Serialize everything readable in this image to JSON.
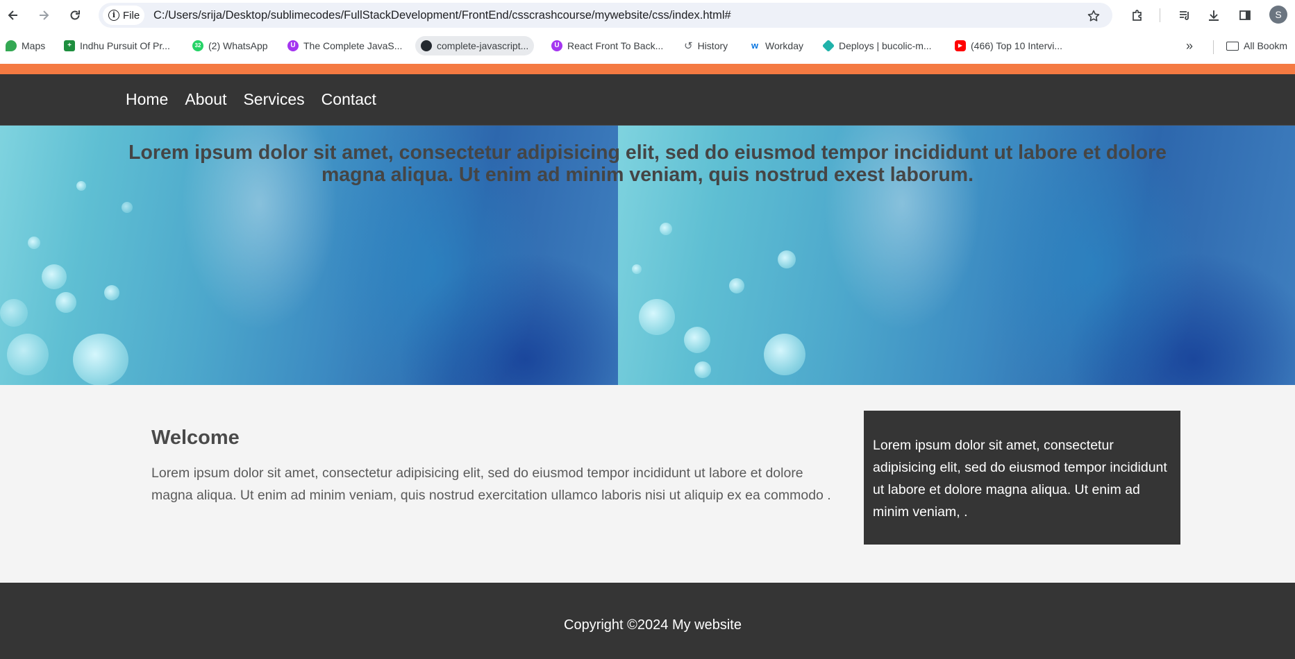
{
  "browser": {
    "site_chip_label": "File",
    "url": "C:/Users/srija/Desktop/sublimecodes/FullStackDevelopment/FrontEnd/csscrashcourse/mywebsite/css/index.html#",
    "profile_initial": "S",
    "bookmarks": [
      {
        "label": "Maps",
        "icon": "maps-icon",
        "color": "#34a853"
      },
      {
        "label": "Indhu Pursuit Of Pr...",
        "icon": "sheets-icon",
        "color": "#1e8e3e"
      },
      {
        "label": "(2) WhatsApp",
        "icon": "whatsapp-icon",
        "color": "#25d366",
        "badge": "32"
      },
      {
        "label": "The Complete JavaS...",
        "icon": "udemy-icon",
        "color": "#a435f0"
      },
      {
        "label": "complete-javascript...",
        "icon": "github-icon",
        "color": "#24292f"
      },
      {
        "label": "React Front To Back...",
        "icon": "udemy-icon",
        "color": "#a435f0"
      },
      {
        "label": "History",
        "icon": "history-icon",
        "color": "#5f6368"
      },
      {
        "label": "Workday",
        "icon": "workday-icon",
        "color": "#f5a623"
      },
      {
        "label": "Deploys | bucolic-m...",
        "icon": "netlify-icon",
        "color": "#20b2aa"
      },
      {
        "label": "(466) Top 10 Intervi...",
        "icon": "youtube-icon",
        "color": "#ff0000"
      }
    ],
    "all_bookmarks_label": "All Bookm"
  },
  "nav": {
    "items": [
      "Home",
      "About",
      "Services",
      "Contact"
    ]
  },
  "showcase": {
    "heading": "Lorem ipsum dolor sit amet, consectetur adipisicing elit, sed do eiusmod tempor incididunt ut labore et dolore magna aliqua. Ut enim ad minim veniam, quis nostrud exest laborum."
  },
  "main": {
    "title": "Welcome",
    "text": "Lorem ipsum dolor sit amet, consectetur adipisicing elit, sed do eiusmod tempor incididunt ut labore et dolore magna aliqua. Ut enim ad minim veniam, quis nostrud exercitation ullamco laboris nisi ut aliquip ex ea commodo ."
  },
  "sidebar": {
    "text": "Lorem ipsum dolor sit amet, consectetur adipisicing elit, sed do eiusmod tempor incididunt ut labore et dolore magna aliqua. Ut enim ad minim veniam, ."
  },
  "footer": {
    "text": "Copyright ©2024 My website"
  },
  "colors": {
    "accent_bar": "#f47a42",
    "dark": "#353535",
    "content_bg": "#f4f4f4"
  }
}
